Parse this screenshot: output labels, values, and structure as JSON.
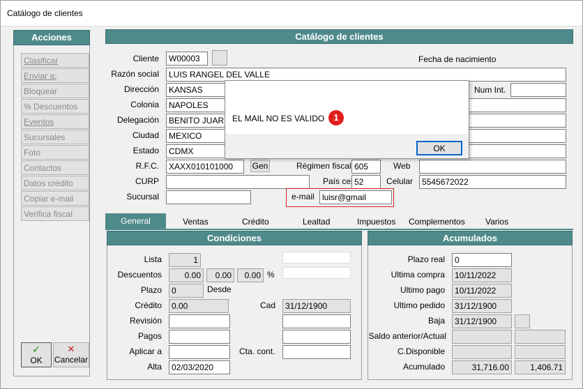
{
  "window": {
    "title": "Catálogo de clientes"
  },
  "sidebar": {
    "header": "Acciones",
    "items": [
      "Clasificar",
      "Enviar a:",
      "Bloquear",
      "% Descuentos",
      "Eventos",
      "Sucursales",
      "Foto",
      "Contactos",
      "Datos crédito",
      "Copiar e-mail",
      "Verifica fiscal"
    ]
  },
  "footer": {
    "ok_label": "OK",
    "cancel_label": "Cancelar",
    "ok_icon": "✓",
    "cancel_icon": "✕"
  },
  "form": {
    "header": "Catálogo de clientes",
    "cliente_label": "Cliente",
    "cliente": "W00003",
    "fecha_nac_label": "Fecha de nacimiento",
    "razon_label": "Razón social",
    "razon": "LUIS RANGEL DEL VALLE",
    "direccion_label": "Dirección",
    "direccion": "KANSAS",
    "numint_label": "Num Int.",
    "colonia_label": "Colonia",
    "colonia": "NAPOLES",
    "delegacion_label": "Delegación",
    "delegacion": "BENITO JUAREZ",
    "ciudad_label": "Ciudad",
    "ciudad": "MEXICO",
    "estado_label": "Estado",
    "estado": "CDMX",
    "rfc_label": "R.F.C.",
    "rfc": "XAXX010101000",
    "gen_label": "Gen",
    "regimen_label": "Régimen fiscal",
    "regimen": "605",
    "web_label": "Web",
    "curp_label": "CURP",
    "paiscel_label": "País cel",
    "paiscel": "52",
    "celular_label": "Celular",
    "celular": "5545672022",
    "sucursal_label": "Sucursal",
    "email_label": "e-mail",
    "email": "luisr@gmail"
  },
  "dialog": {
    "message": "EL MAIL NO ES VALIDO",
    "badge": "1",
    "ok_label": "OK"
  },
  "tabs": [
    "General",
    "Ventas",
    "Crédito",
    "Lealtad",
    "Impuestos",
    "Complementos",
    "Varios"
  ],
  "condiciones": {
    "header": "Condiciones",
    "lista_label": "Lista",
    "lista": "1",
    "descuentos_label": "Descuentos",
    "desc1": "0.00",
    "desc2": "0.00",
    "desc3": "0.00",
    "pct": "%",
    "plazo_label": "Plazo",
    "plazo": "0",
    "desde_label": "Desde",
    "credito_label": "Crédito",
    "credito": "0.00",
    "cad_label": "Cad",
    "cad": "31/12/1900",
    "revision_label": "Revisión",
    "pagos_label": "Pagos",
    "aplicar_label": "Aplicar a",
    "ctacont_label": "Cta. cont.",
    "alta_label": "Alta",
    "alta": "02/03/2020"
  },
  "acumulados": {
    "header": "Acumulados",
    "plazoreal_label": "Plazo real",
    "plazoreal": "0",
    "ultcompra_label": "Ultima compra",
    "ultcompra": "10/11/2022",
    "ultpago_label": "Ultimo pago",
    "ultpago": "10/11/2022",
    "ultpedido_label": "Ultimo pedido",
    "ultpedido": "31/12/1900",
    "baja_label": "Baja",
    "baja": "31/12/1900",
    "saldo_label": "Saldo anterior/Actual",
    "cdisp_label": "C.Disponible",
    "acum_label": "Acumulado",
    "acum1": "31,716.00",
    "acum2": "1,406.71"
  }
}
